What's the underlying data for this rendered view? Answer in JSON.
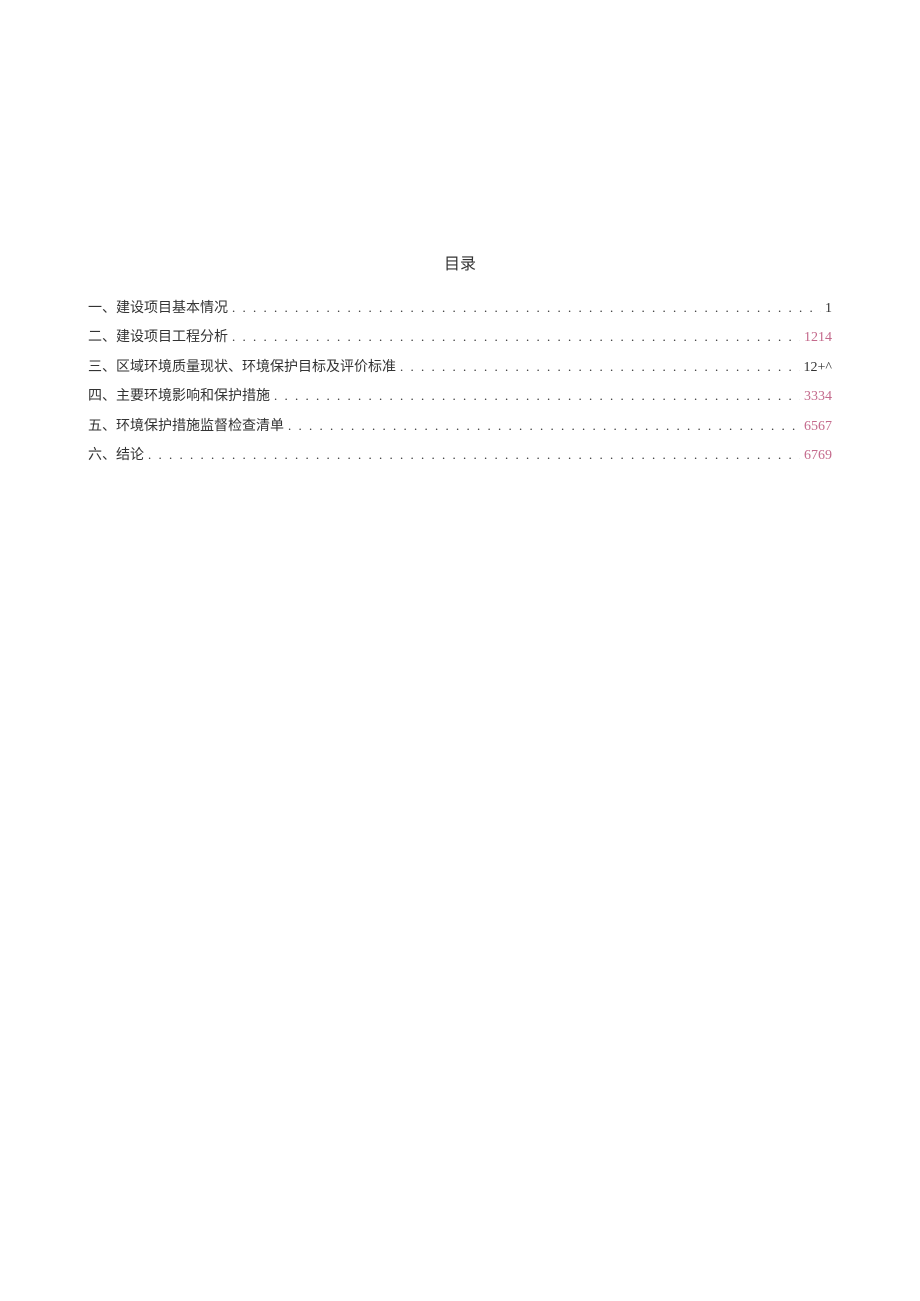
{
  "title": "目录",
  "items": [
    {
      "label": "一、建设项目基本情况",
      "page": "1",
      "pageClass": "pg-dark"
    },
    {
      "label": "二、建设项目工程分析",
      "page": "1214",
      "pageSuffix": "",
      "pageClass": "pg-pink"
    },
    {
      "label": "三、区域环境质量现状、环境保护目标及评价标准",
      "page": "12",
      "pageSuffix": "+^",
      "pageClass": "pg-dark"
    },
    {
      "label": "四、主要环境影响和保护措施",
      "page": "3334",
      "pageClass": "pg-pink"
    },
    {
      "label": "五、环境保护措施监督检查清单",
      "page": "6567",
      "pageClass": "pg-pink"
    },
    {
      "label": "六、结论",
      "page": "6769",
      "pageClass": "pg-pink"
    }
  ]
}
